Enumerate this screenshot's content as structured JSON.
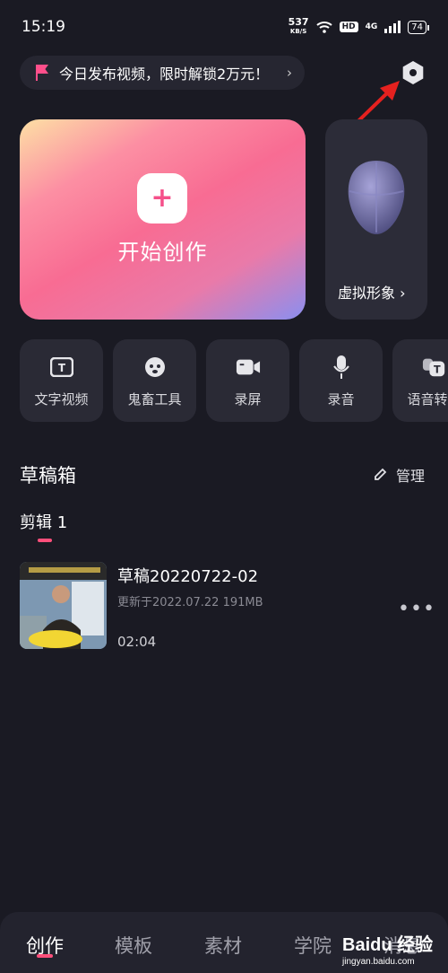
{
  "status_bar": {
    "time": "15:19",
    "net_speed": "537",
    "net_unit": "KB/S",
    "hd": "HD",
    "network": "4G",
    "battery": "74",
    "icons": [
      "wifi-icon",
      "signal-icon",
      "battery-icon"
    ]
  },
  "promo_banner": {
    "text": "今日发布视频，限时解锁2万元！",
    "chevron": "›"
  },
  "start_card": {
    "plus": "+",
    "label": "开始创作"
  },
  "avatar_card": {
    "label": "虚拟形象 ›"
  },
  "tools": [
    {
      "label": "文字视频",
      "icon": "text-video-icon"
    },
    {
      "label": "鬼畜工具",
      "icon": "kichiku-tool-icon"
    },
    {
      "label": "录屏",
      "icon": "screen-record-icon"
    },
    {
      "label": "录音",
      "icon": "microphone-icon"
    },
    {
      "label": "语音转字",
      "icon": "speech-to-text-icon"
    }
  ],
  "drafts": {
    "title": "草稿箱",
    "manage_label": "管理",
    "tab_label": "剪辑 1",
    "item": {
      "title": "草稿20220722-02",
      "meta": "更新于2022.07.22  191MB",
      "duration": "02:04",
      "more": "•••"
    }
  },
  "bottom_nav": {
    "items": [
      "创作",
      "模板",
      "素材",
      "学院",
      "消息"
    ],
    "active": "创作"
  },
  "watermark": {
    "brand": "Baidu 经验",
    "sub": "jingyan.baidu.com"
  },
  "colors": {
    "background": "#1a1a23",
    "accent": "#ff4f7b",
    "card": "#2a2a35",
    "annotation_arrow": "#e5211f"
  }
}
